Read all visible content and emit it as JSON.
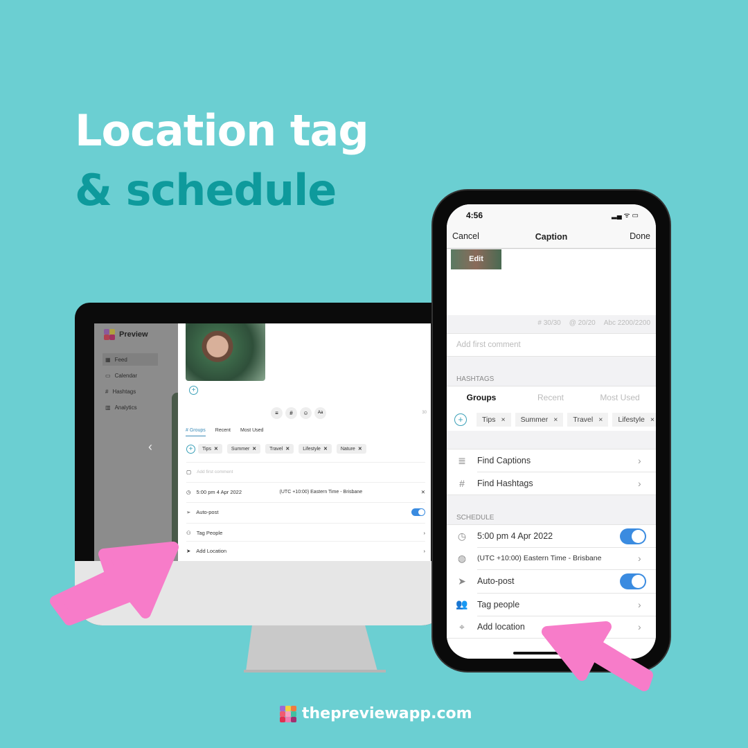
{
  "headline": {
    "line1": "Location tag",
    "line2": "& schedule"
  },
  "colors": {
    "background": "#6bcfd2",
    "headline_accent": "#0e9a9c",
    "arrow": "#f77cc9",
    "toggle": "#3a8be0"
  },
  "desktop": {
    "brand": "Preview",
    "sidebar": [
      {
        "icon": "grid-icon",
        "label": "Feed"
      },
      {
        "icon": "calendar-icon",
        "label": "Calendar"
      },
      {
        "icon": "hash-icon",
        "label": "Hashtags"
      },
      {
        "icon": "chart-icon",
        "label": "Analytics"
      }
    ],
    "toolbar_count": "30",
    "toolbar_aa": "Aa",
    "tabs": [
      "# Groups",
      "Recent",
      "Most Used"
    ],
    "chips": [
      "Tips",
      "Summer",
      "Travel",
      "Lifestyle",
      "Nature"
    ],
    "comment_placeholder": "Add first comment",
    "schedule_time": "5:00 pm  4 Apr 2022",
    "timezone": "(UTC +10:00) Eastern Time - Brisbane",
    "autopost": "Auto-post",
    "tag_people": "Tag People",
    "add_location": "Add Location"
  },
  "phone": {
    "time": "4:56",
    "nav": {
      "cancel": "Cancel",
      "title": "Caption",
      "done": "Done"
    },
    "edit_label": "Edit",
    "counters": {
      "hashtags": "# 30/30",
      "mentions": "@ 20/20",
      "chars": "Abc 2200/2200"
    },
    "comment_placeholder": "Add first comment",
    "hashtags_header": "HASHTAGS",
    "tabs": [
      "Groups",
      "Recent",
      "Most Used"
    ],
    "chips": [
      "Tips",
      "Summer",
      "Travel",
      "Lifestyle"
    ],
    "find_captions": "Find Captions",
    "find_hashtags": "Find Hashtags",
    "schedule_header": "SCHEDULE",
    "schedule_time": "5:00 pm  4 Apr 2022",
    "timezone": "(UTC +10:00) Eastern Time - Brisbane",
    "autopost": "Auto-post",
    "tag_people": "Tag people",
    "add_location": "Add location"
  },
  "footer": {
    "url": "thepreviewapp.com"
  }
}
